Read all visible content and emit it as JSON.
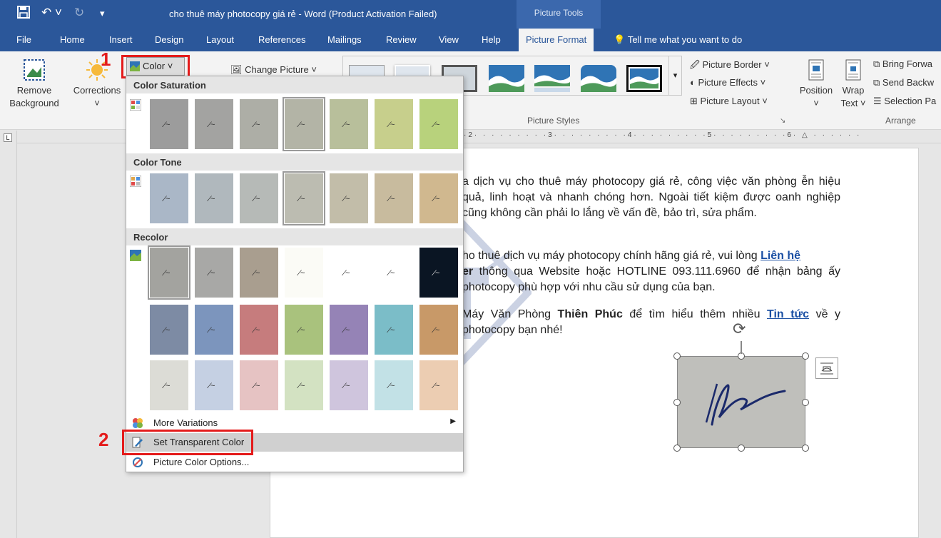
{
  "title_bar": {
    "title": "cho thuê máy photocopy giá rẻ  -  Word (Product Activation Failed)",
    "context_label": "Picture Tools"
  },
  "tabs": [
    "File",
    "Home",
    "Insert",
    "Design",
    "Layout",
    "References",
    "Mailings",
    "Review",
    "View",
    "Help",
    "Picture Format"
  ],
  "tell_me": "Tell me what you want to do",
  "ribbon": {
    "remove_background": [
      "Remove",
      "Background"
    ],
    "corrections": "Corrections",
    "color": "Color",
    "change_picture": "Change Picture",
    "picture_styles_label": "Picture Styles",
    "picture_border": "Picture Border",
    "picture_effects": "Picture Effects",
    "picture_layout": "Picture Layout",
    "position": "Position",
    "wrap_text": [
      "Wrap",
      "Text"
    ],
    "bring_forward": "Bring Forwa",
    "send_backward": "Send Backw",
    "selection_pane": "Selection Pa",
    "arrange_label": "Arrange"
  },
  "steps": {
    "one": "1",
    "two": "2"
  },
  "dropdown": {
    "saturation_header": "Color Saturation",
    "tone_header": "Color Tone",
    "recolor_header": "Recolor",
    "more_variations": "More Variations",
    "set_transparent": "Set Transparent Color",
    "picture_color_options": "Picture Color Options...",
    "saturation_colors": [
      "#9c9c9c",
      "#a3a3a1",
      "#adaea6",
      "#b3b4a6",
      "#b8bf9b",
      "#c7cf8c",
      "#b8d27c"
    ],
    "tone_colors": [
      "#aab7c7",
      "#b0b8bd",
      "#b6bab7",
      "#bcbcb1",
      "#c2bda9",
      "#c8bb9e",
      "#d0b88f"
    ],
    "recolor_row1": [
      "#a3a39f",
      "#a8a8a6",
      "#a99e8f",
      "#fbfbf6",
      "#ffffff",
      "#ffffff",
      "#0a1523"
    ],
    "recolor_row2": [
      "#7d8ba4",
      "#7c95bd",
      "#c67c7d",
      "#a9c27d",
      "#9583b6",
      "#7bbdc8",
      "#c89968"
    ],
    "recolor_row3": [
      "#dcdcd6",
      "#c5d0e3",
      "#e6c3c3",
      "#d3e2c2",
      "#cfc5dd",
      "#c2e1e6",
      "#eccdb2"
    ]
  },
  "document": {
    "p1": "a dịch vụ cho thuê máy photocopy giá rẻ, công việc văn phòng ễn hiệu quả, linh hoạt và nhanh chóng hơn. Ngoài tiết kiệm được oanh nghiệp cũng không cần phải lo lắng về vấn đề, bảo trì, sửa phẩm.",
    "p2_a": "ho thuê dịch vụ máy photocopy chính hãng giá rẻ, vui lòng ",
    "p2_link": "Liên hệ",
    "p2_bold": "er",
    "p2_b": " thông qua Website hoặc HOTLINE 093.111.6960 để nhận bảng ấy photocopy phù hợp với nhu cầu sử dụng của bạn.",
    "p3_a": " Máy Văn Phòng ",
    "p3_bold": "Thiên Phúc",
    "p3_b": " để tìm hiểu thêm nhiều ",
    "p3_link": "Tin tức",
    "p3_c": " về y photocopy bạn nhé!"
  }
}
